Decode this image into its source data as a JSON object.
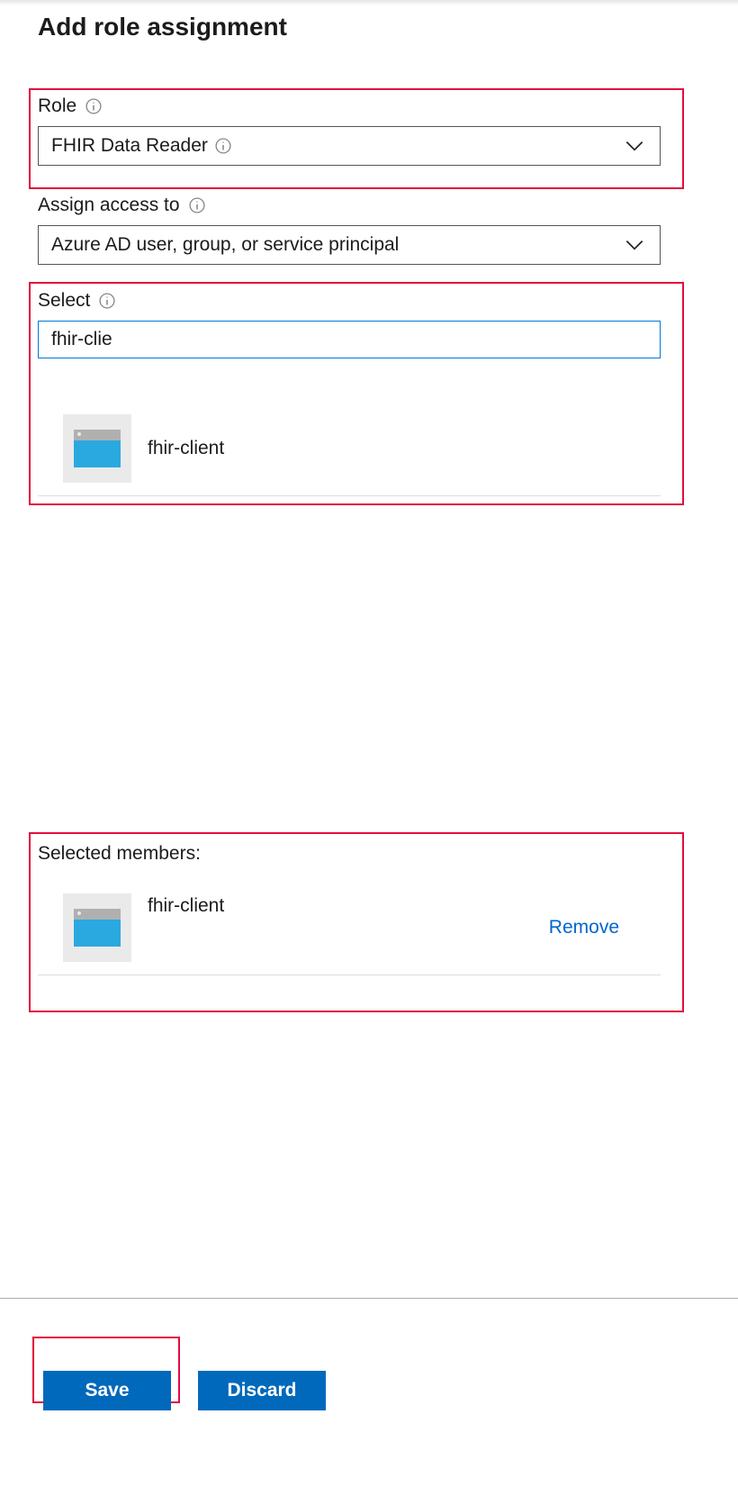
{
  "page_title": "Add role assignment",
  "role": {
    "label": "Role",
    "selected": "FHIR Data Reader"
  },
  "assign_access": {
    "label": "Assign access to",
    "selected": "Azure AD user, group, or service principal"
  },
  "select": {
    "label": "Select",
    "input_value": "fhir-clie",
    "results": [
      {
        "name": "fhir-client"
      }
    ]
  },
  "selected_members": {
    "heading": "Selected members:",
    "items": [
      {
        "name": "fhir-client",
        "remove_label": "Remove"
      }
    ]
  },
  "buttons": {
    "save": "Save",
    "discard": "Discard"
  }
}
